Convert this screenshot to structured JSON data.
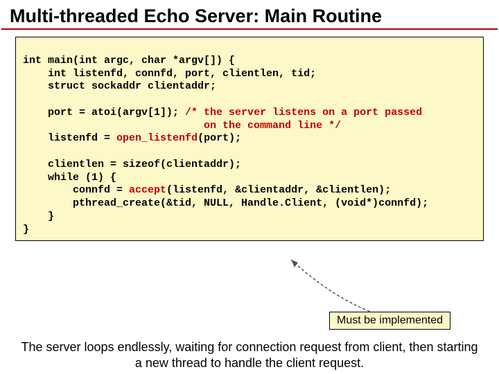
{
  "title": "Multi-threaded Echo Server: Main Routine",
  "code": {
    "l1": "int main(int argc, char *argv[]) {",
    "l2": "    int listenfd, connfd, port, clientlen, tid;",
    "l3": "    struct sockaddr clientaddr;",
    "l4": "",
    "l5a": "    port = atoi(argv[1]); ",
    "l5b": "/* the server listens on a port passed",
    "l6": "                             on the command line */",
    "l7a": "    listenfd = ",
    "l7b": "open_listenfd",
    "l7c": "(port);",
    "l8": "",
    "l9": "    clientlen = sizeof(clientaddr);",
    "l10": "    while (1) {",
    "l11a": "        connfd = ",
    "l11b": "accept",
    "l11c": "(listenfd, &clientaddr, &clientlen);",
    "l12": "        pthread_create(&tid, NULL, Handle.Client, (void*)connfd);",
    "l13": "    }",
    "l14": "}"
  },
  "callout": "Must be implemented",
  "footer": "The server loops endlessly, waiting for connection request from client, then starting a new thread to handle the client request."
}
